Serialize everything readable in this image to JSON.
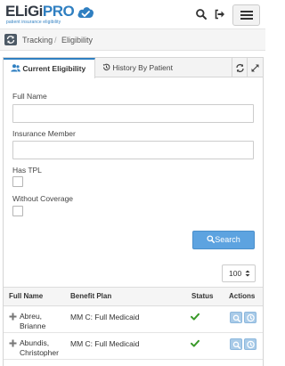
{
  "header": {
    "logo_text_dark": "ELiGi",
    "logo_text_blue": "PRO",
    "logo_tagline": "patient insurance eligibility",
    "icons": [
      "search-icon",
      "sign-out-icon",
      "menu-icon"
    ]
  },
  "breadcrumb": {
    "icon": "refresh-icon",
    "items": [
      "Tracking",
      "Eligibility"
    ],
    "separator": "/"
  },
  "tabs": {
    "active_label": "Current Eligibility",
    "active_icon": "users-icon",
    "inactive_label": "History By Patient",
    "inactive_icon": "history-icon",
    "tools": [
      "refresh-icon",
      "expand-icon"
    ]
  },
  "form": {
    "full_name_label": "Full Name",
    "full_name_value": "",
    "insurance_member_label": "Insurance Member",
    "insurance_member_value": "",
    "has_tpl_label": "Has TPL",
    "without_coverage_label": "Without Coverage",
    "search_label": "Search"
  },
  "page_size": "100",
  "table": {
    "headers": {
      "name": "Full Name",
      "plan": "Benefit Plan",
      "status": "Status",
      "actions": "Actions"
    },
    "rows": [
      {
        "name": "Abreu, Brianne",
        "plan": "MM C: Full Medicaid",
        "status": "active"
      },
      {
        "name": "Abundis, Christopher",
        "plan": "MM C: Full Medicaid",
        "status": "active"
      }
    ]
  },
  "colors": {
    "brand_blue": "#2f7fc1",
    "primary_button": "#5da3e0",
    "status_ok": "#3a9a2a",
    "action_button": "#a9cbe8"
  }
}
